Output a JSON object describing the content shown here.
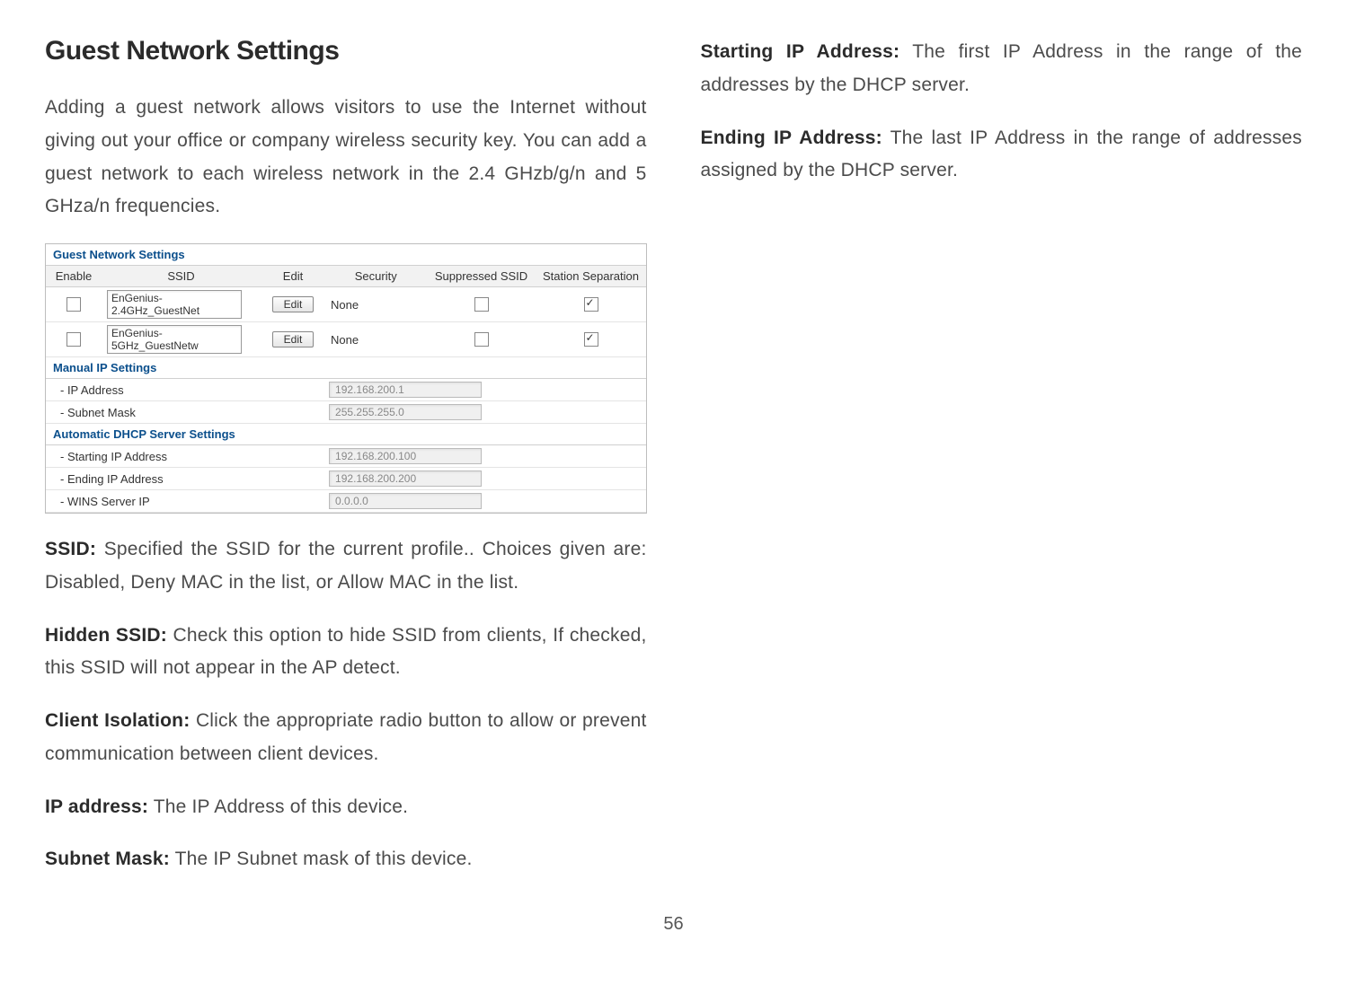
{
  "left": {
    "heading": "Guest Network Settings",
    "intro": "Adding a guest network allows visitors to use the Internet without giving out your office or company wireless security key. You can add a guest network to each wireless network in the  2.4 GHzb/g/n and 5 GHza/n frequencies.",
    "panel": {
      "title": "Guest Network Settings",
      "cols": {
        "enable": "Enable",
        "ssid": "SSID",
        "edit": "Edit",
        "security": "Security",
        "suppressed": "Suppressed SSID",
        "station": "Station Separation"
      },
      "rows": [
        {
          "ssid": "EnGenius-2.4GHz_GuestNet",
          "edit": "Edit",
          "security": "None"
        },
        {
          "ssid": "EnGenius-5GHz_GuestNetw",
          "edit": "Edit",
          "security": "None"
        }
      ],
      "manual_title": "Manual IP Settings",
      "manual": [
        {
          "label": "- IP Address",
          "value": "192.168.200.1"
        },
        {
          "label": "- Subnet Mask",
          "value": "255.255.255.0"
        }
      ],
      "dhcp_title": "Automatic DHCP Server Settings",
      "dhcp": [
        {
          "label": "- Starting IP Address",
          "value": "192.168.200.100"
        },
        {
          "label": "- Ending IP Address",
          "value": "192.168.200.200"
        },
        {
          "label": "- WINS Server IP",
          "value": "0.0.0.0"
        }
      ]
    },
    "ssid_label": "SSID:",
    "ssid_text": " Specified the SSID for the current profile.. Choices given are: Disabled, Deny MAC in the list, or Allow MAC in the list.",
    "hidden_label": "Hidden SSID:",
    "hidden_text": " Check this option to hide SSID from clients, If checked, this SSID will not appear in the AP detect.",
    "client_label": "Client Isolation:",
    "client_text": " Click the appropriate radio button to allow or prevent communication between client devices.",
    "ip_label": "IP address:",
    "ip_text": " The IP Address of this device.",
    "subnet_label": "Subnet Mask:",
    "subnet_text": " The IP Subnet mask of this device."
  },
  "right": {
    "start_label": "Starting IP Address:",
    "start_text": " The first IP Address in the range of the addresses by the DHCP server.",
    "end_label": "Ending IP Address:",
    "end_text": " The last IP Address in the range of addresses assigned by the DHCP server."
  },
  "page": "56"
}
